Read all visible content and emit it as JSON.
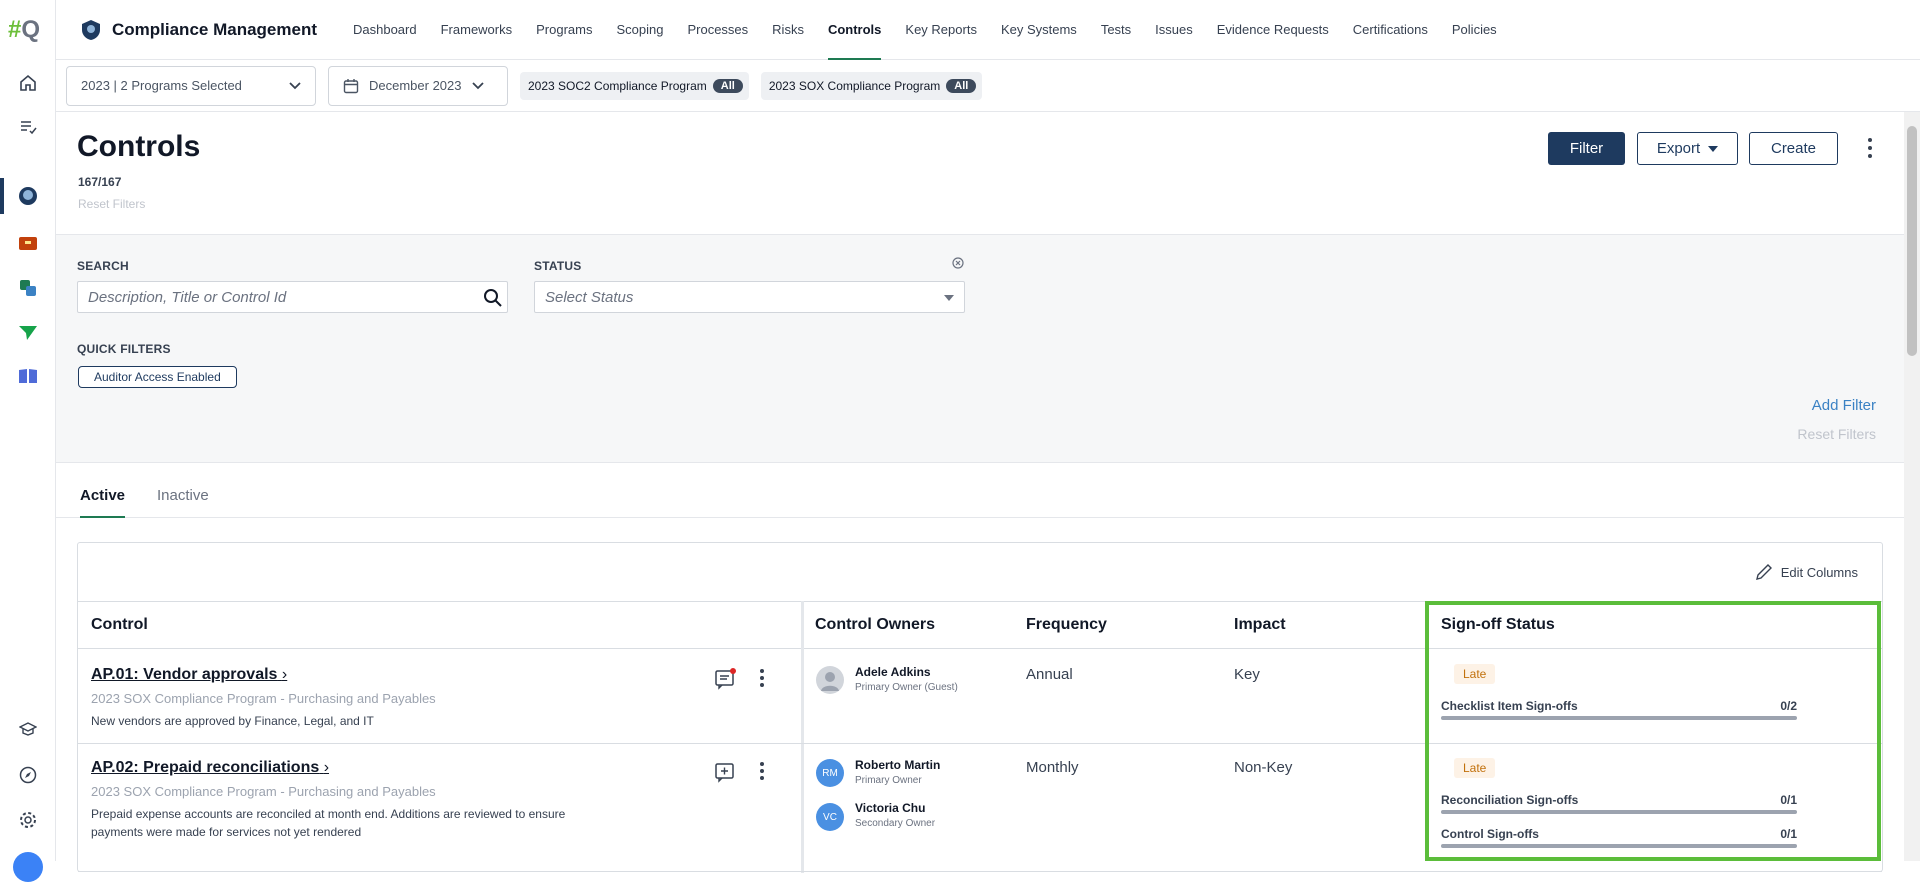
{
  "app": {
    "title": "Compliance Management",
    "nav": [
      "Dashboard",
      "Frameworks",
      "Programs",
      "Scoping",
      "Processes",
      "Risks",
      "Controls",
      "Key Reports",
      "Key Systems",
      "Tests",
      "Issues",
      "Evidence Requests",
      "Certifications",
      "Policies"
    ],
    "active_nav": "Controls",
    "logo_text": "#Q"
  },
  "filterbar": {
    "program_select": "2023 | 2 Programs Selected",
    "period_select": "December 2023",
    "chips": [
      {
        "label": "2023 SOC2 Compliance Program",
        "pill": "All"
      },
      {
        "label": "2023 SOX Compliance Program",
        "pill": "All"
      }
    ]
  },
  "header": {
    "title": "Controls",
    "count": "167/167",
    "reset_filters": "Reset Filters",
    "filter_button": "Filter",
    "export_button": "Export",
    "create_button": "Create"
  },
  "filters": {
    "search_label": "SEARCH",
    "search_placeholder": "Description, Title or Control Id",
    "status_label": "STATUS",
    "status_placeholder": "Select Status",
    "quick_filters_label": "QUICK FILTERS",
    "quick_filter_chip": "Auditor Access Enabled",
    "add_filter": "Add Filter",
    "reset_filters": "Reset Filters"
  },
  "tabs": [
    "Active",
    "Inactive"
  ],
  "table": {
    "edit_columns": "Edit Columns",
    "columns": [
      "Control",
      "Control Owners",
      "Frequency",
      "Impact",
      "Sign-off Status"
    ],
    "rows": [
      {
        "title": "AP.01: Vendor approvals",
        "program": "2023 SOX Compliance Program - Purchasing and Payables",
        "description": "New vendors are approved by Finance, Legal, and IT",
        "owners": [
          {
            "name": "Adele Adkins",
            "role": "Primary Owner (Guest)",
            "initials": ""
          }
        ],
        "frequency": "Annual",
        "impact": "Key",
        "status": "Late",
        "signoffs": [
          {
            "label": "Checklist Item Sign-offs",
            "value": "0/2",
            "fraction": 0
          }
        ]
      },
      {
        "title": "AP.02: Prepaid reconciliations",
        "program": "2023 SOX Compliance Program - Purchasing and Payables",
        "description": "Prepaid expense accounts are reconciled at month end. Additions are reviewed to ensure payments were made for services not yet rendered",
        "owners": [
          {
            "name": "Roberto Martin",
            "role": "Primary Owner",
            "initials": "RM"
          },
          {
            "name": "Victoria Chu",
            "role": "Secondary Owner",
            "initials": "VC"
          }
        ],
        "frequency": "Monthly",
        "impact": "Non-Key",
        "status": "Late",
        "signoffs": [
          {
            "label": "Reconciliation Sign-offs",
            "value": "0/1",
            "fraction": 0
          },
          {
            "label": "Control Sign-offs",
            "value": "0/1",
            "fraction": 0
          }
        ]
      }
    ]
  },
  "colors": {
    "primary": "#1e3a5f",
    "accent": "#1e7a52",
    "highlight": "#5bbd3a",
    "late": "#c2710c"
  }
}
